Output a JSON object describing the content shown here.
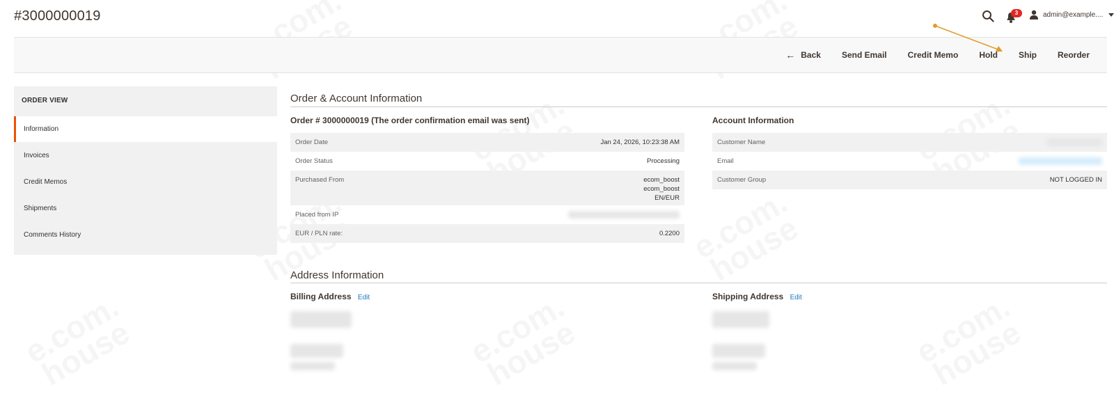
{
  "header": {
    "title": "#3000000019",
    "notification_count": "3",
    "user": "admin@example...."
  },
  "actions": {
    "back": "Back",
    "send_email": "Send Email",
    "credit_memo": "Credit Memo",
    "hold": "Hold",
    "ship": "Ship",
    "reorder": "Reorder"
  },
  "sidebar": {
    "title": "ORDER VIEW",
    "items": [
      {
        "label": "Information",
        "active": true
      },
      {
        "label": "Invoices"
      },
      {
        "label": "Credit Memos"
      },
      {
        "label": "Shipments"
      },
      {
        "label": "Comments History"
      }
    ]
  },
  "order_account": {
    "section_title": "Order & Account Information",
    "order": {
      "title": "Order # 3000000019 (The order confirmation email was sent)",
      "order_date_label": "Order Date",
      "order_date": "Jan 24, 2026, 10:23:38 AM",
      "status_label": "Order Status",
      "status": "Processing",
      "purchased_from_label": "Purchased From",
      "purchased_from": [
        "ecom_boost",
        "ecom_boost",
        "EN/EUR"
      ],
      "ip_label": "Placed from IP",
      "rate_label": "EUR / PLN rate:",
      "rate": "0.2200"
    },
    "account": {
      "title": "Account Information",
      "customer_name_label": "Customer Name",
      "email_label": "Email",
      "group_label": "Customer Group",
      "group": "NOT LOGGED IN"
    }
  },
  "address": {
    "section_title": "Address Information",
    "billing_title": "Billing Address",
    "shipping_title": "Shipping Address",
    "edit_label": "Edit"
  },
  "watermark": "e.com. house",
  "colors": {
    "accent": "#eb5202",
    "link": "#1979c3",
    "badge": "#e22626",
    "annotation": "#e39a2a"
  }
}
